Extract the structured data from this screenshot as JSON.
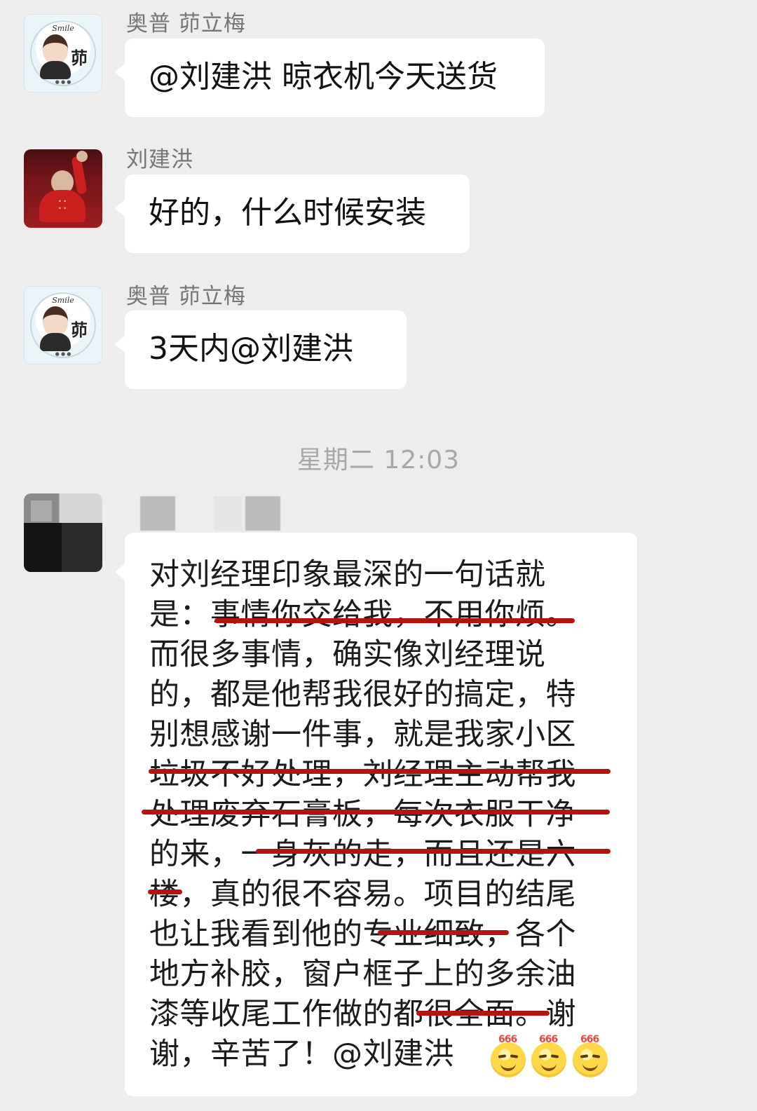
{
  "messages": [
    {
      "sender": "奥普 茆立梅",
      "text": "@刘建洪 晾衣机今天送货"
    },
    {
      "sender": "刘建洪",
      "text": "好的，什么时候安装"
    },
    {
      "sender": "奥普 茆立梅",
      "text": "3天内@刘建洪"
    }
  ],
  "timestamp": "星期二 12:03",
  "long_message": {
    "lines": [
      "对刘经理印象最深的一句话就",
      "是：事情你交给我，不用你烦。",
      "而很多事情，确实像刘经理说",
      "的，都是他帮我很好的搞定，特",
      "别想感谢一件事，就是我家小区",
      "垃圾不好处理，刘经理主动帮我",
      "处理废弃石膏板，每次衣服干净",
      "的来，一身灰的走，而且还是六",
      "楼，真的很不容易。项目的结尾",
      "也让我看到他的专业细致，各个",
      "地方补胶，窗户框子上的多余油",
      "漆等收尾工作做的都很全面。谢",
      "谢，辛苦了！@刘建洪"
    ]
  },
  "emoji_labels": [
    "666",
    "666",
    "666"
  ],
  "colors": {
    "background": "#ededed",
    "bubble": "#ffffff",
    "underline": "#b41411",
    "sender": "#767676",
    "timestamp": "#a7a7a7"
  },
  "icons": {
    "avatar_1": "girl-avatar-icon",
    "avatar_2": "red-shirt-avatar-icon",
    "avatar_3": "blurred-avatar-icon",
    "emoji": "666-emoji-icon"
  }
}
